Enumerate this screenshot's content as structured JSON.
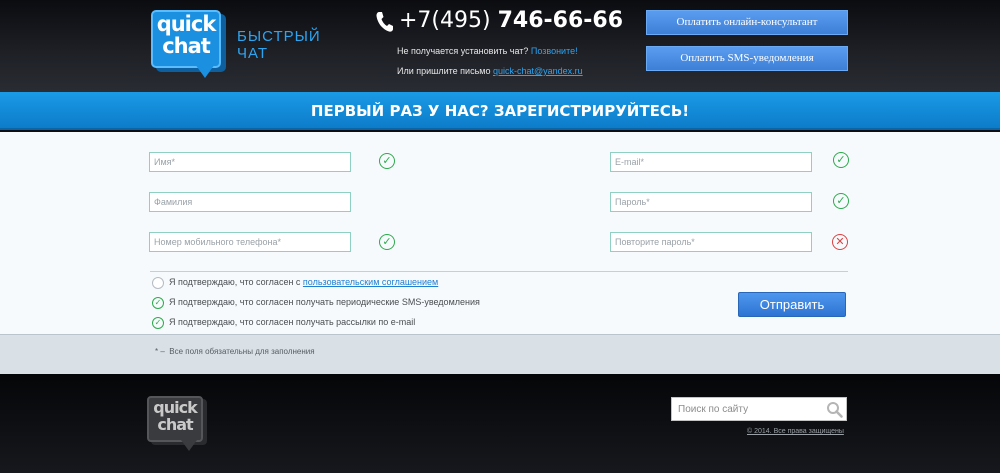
{
  "header": {
    "logo_line1": "quick",
    "logo_line2": "chat",
    "logo_caption_line1": "БЫСТРЫЙ",
    "logo_caption_line2": "ЧАТ",
    "phone_prefix": "+7(495)",
    "phone_number": "746-66-66",
    "hint_line1": "Не получается установить чат?",
    "hint_call_link": "Позвоните!",
    "hint_line2": "Или пришлите письмо",
    "hint_email_link": "quick-chat@yandex.ru",
    "pay_consultant_button": "Оплатить онлайн-консультант",
    "pay_sms_button": "Оплатить SMS-уведомления"
  },
  "banner": {
    "title": "ПЕРВЫЙ РАЗ У НАС? ЗАРЕГИСТРИРУЙТЕСЬ!"
  },
  "form": {
    "fields": {
      "first_name": {
        "placeholder": "Имя*",
        "value": "",
        "status": "ok"
      },
      "last_name": {
        "placeholder": "Фамилия",
        "value": "",
        "status": "none"
      },
      "mobile": {
        "placeholder": "Номер мобильного телефона*",
        "value": "",
        "status": "ok"
      },
      "email": {
        "placeholder": "E-mail*",
        "value": "",
        "status": "ok"
      },
      "password": {
        "placeholder": "Пароль*",
        "value": "",
        "status": "ok"
      },
      "password_repeat": {
        "placeholder": "Повторите пароль*",
        "value": "",
        "status": "error"
      }
    },
    "agreements": [
      {
        "text": "Я подтверждаю, что согласен с ",
        "link": "пользовательским соглашением",
        "checked": false
      },
      {
        "text": "Я подтверждаю, что согласен получать периодические SMS-уведомления",
        "link": "",
        "checked": true
      },
      {
        "text": "Я подтверждаю, что согласен получать рассылки по e-mail",
        "link": "",
        "checked": true
      }
    ],
    "submit_label": "Отправить",
    "required_note_mark": "* –",
    "required_note": "Все поля обязательны для заполнения"
  },
  "footer": {
    "logo_line1": "quick",
    "logo_line2": "chat",
    "search_placeholder": "Поиск по сайту",
    "search_value": "",
    "copyright": "© 2014. Все права защищены"
  },
  "colors": {
    "accent_blue": "#1a9ae6",
    "button_blue": "#4e97ee",
    "ok_green": "#2eaa4d",
    "error_red": "#d84343"
  },
  "icons": {
    "phone": "phone-icon",
    "ok": "check-circle-icon",
    "error": "x-circle-icon",
    "search": "search-icon"
  }
}
